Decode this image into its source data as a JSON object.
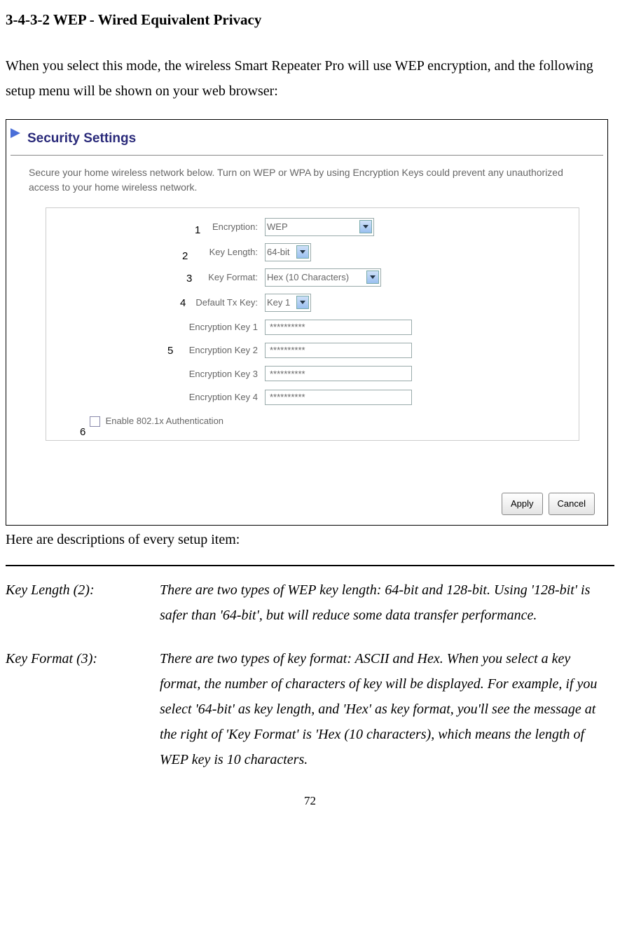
{
  "heading": "3-4-3-2 WEP - Wired Equivalent Privacy",
  "intro": "When you select this mode, the wireless Smart Repeater Pro will use WEP encryption, and the following setup menu will be shown on your web browser:",
  "screenshot": {
    "title": "Security Settings",
    "description": "Secure your home wireless network below. Turn on WEP or WPA by using Encryption Keys could prevent any unauthorized access to your home wireless network.",
    "rows": {
      "encryption": {
        "label": "Encryption:",
        "value": "WEP"
      },
      "key_length": {
        "label": "Key Length:",
        "value": "64-bit"
      },
      "key_format": {
        "label": "Key Format:",
        "value": "Hex (10 Characters)"
      },
      "default_tx": {
        "label": "Default Tx Key:",
        "value": "Key 1"
      },
      "k1": {
        "label": "Encryption Key 1",
        "value": "**********"
      },
      "k2": {
        "label": "Encryption Key 2",
        "value": "**********"
      },
      "k3": {
        "label": "Encryption Key 3",
        "value": "**********"
      },
      "k4": {
        "label": "Encryption Key 4",
        "value": "**********"
      }
    },
    "auth_checkbox": "Enable 802.1x Authentication",
    "buttons": {
      "apply": "Apply",
      "cancel": "Cancel"
    },
    "callouts": {
      "c1": "1",
      "c2": "2",
      "c3": "3",
      "c4": "4",
      "c5": "5",
      "c6": "6"
    }
  },
  "after_frame": "Here are descriptions of every setup item:",
  "descriptions": {
    "key_length": {
      "label": "Key Length (2):",
      "text": "There are two types of WEP key length: 64-bit and 128-bit. Using '128-bit' is safer than '64-bit', but will reduce some data transfer performance."
    },
    "key_format": {
      "label": "Key Format (3):",
      "text": "There are two types of key format: ASCII and Hex. When you select a key format, the number of characters of key will be displayed. For example, if you select '64-bit' as key length, and 'Hex' as key format, you'll see the message at the right of 'Key Format' is 'Hex (10 characters), which means the length of WEP key is 10 characters."
    }
  },
  "page_number": "72"
}
